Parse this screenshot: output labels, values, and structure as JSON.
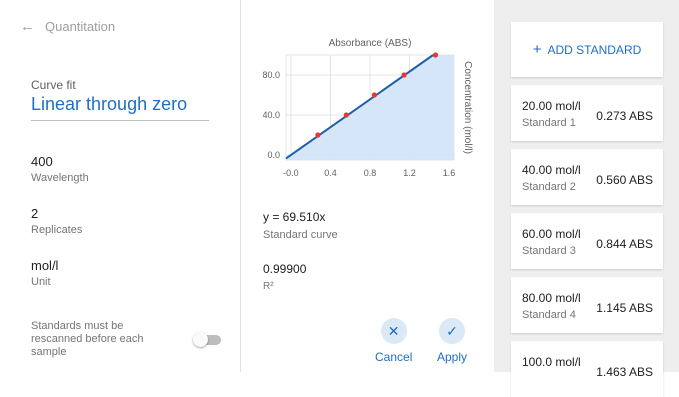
{
  "header": {
    "back_title": "Quantitation"
  },
  "left": {
    "curve_fit_label": "Curve fit",
    "curve_fit_value": "Linear through zero",
    "fields": [
      {
        "value": "400",
        "label": "Wavelength"
      },
      {
        "value": "2",
        "label": "Replicates"
      },
      {
        "value": "mol/l",
        "label": "Unit"
      }
    ],
    "rescan_label": "Standards must be rescanned before each sample",
    "rescan_toggle_on": false
  },
  "chart_data": {
    "type": "scatter",
    "title": "Absorbance (ABS)",
    "ylabel": "Concentration (mol/l)",
    "x_ticks": [
      "-0.0",
      "0.4",
      "0.8",
      "1.2",
      "1.6"
    ],
    "y_ticks": [
      "0.0",
      "40.0",
      "80.0"
    ],
    "xlim": [
      -0.05,
      1.65
    ],
    "ylim": [
      -5,
      100
    ],
    "points": [
      {
        "x": 0.273,
        "y": 20.0
      },
      {
        "x": 0.56,
        "y": 40.0
      },
      {
        "x": 0.844,
        "y": 60.0
      },
      {
        "x": 1.145,
        "y": 80.0
      },
      {
        "x": 1.463,
        "y": 100.0
      }
    ],
    "fit": {
      "slope": 69.51,
      "intercept": 0
    },
    "colors": {
      "line": "#1e5fa8",
      "fill": "#cfe3f6",
      "point": "#e53935",
      "grid": "#e4e4e4"
    }
  },
  "results": {
    "equation": "y = 69.510x",
    "equation_label": "Standard curve",
    "r2_value": "0.99900",
    "r2_label": "R²"
  },
  "actions": {
    "cancel": "Cancel",
    "apply": "Apply"
  },
  "standards": {
    "add_label": "ADD STANDARD",
    "items": [
      {
        "conc": "20.00 mol/l",
        "name": "Standard 1",
        "abs": "0.273 ABS"
      },
      {
        "conc": "40.00 mol/l",
        "name": "Standard 2",
        "abs": "0.560 ABS"
      },
      {
        "conc": "60.00 mol/l",
        "name": "Standard 3",
        "abs": "0.844 ABS"
      },
      {
        "conc": "80.00 mol/l",
        "name": "Standard 4",
        "abs": "1.145 ABS"
      },
      {
        "conc": "100.0 mol/l",
        "name": "",
        "abs": "1.463 ABS"
      }
    ]
  },
  "accent_color": "#1e6fc4"
}
